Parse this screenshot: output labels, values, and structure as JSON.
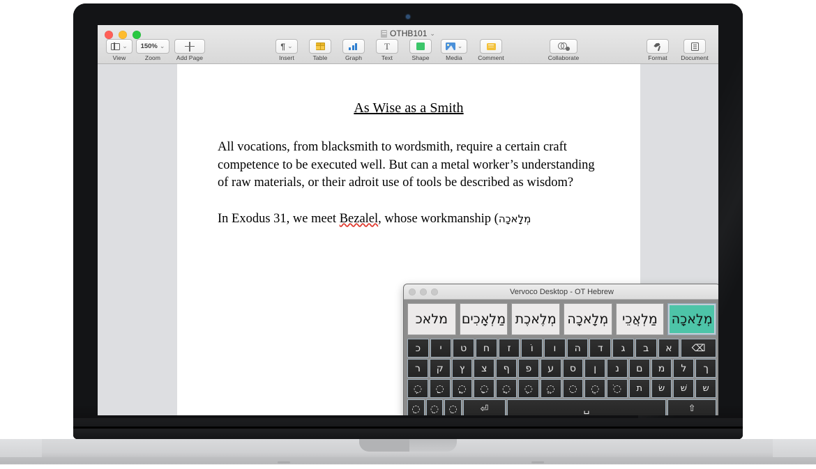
{
  "app": {
    "document_title": "OTHB101",
    "title_chevron": "⌄",
    "window_controls": [
      "close",
      "minimize",
      "zoom"
    ],
    "toolbar": {
      "left": [
        {
          "label": "View",
          "icon": "view-layout-icon",
          "has_chevron": true,
          "value": ""
        },
        {
          "label": "Zoom",
          "icon": "zoom-level-icon",
          "has_chevron": true,
          "value": "150%"
        },
        {
          "label": "Add Page",
          "icon": "plus-icon",
          "has_chevron": false,
          "value": ""
        }
      ],
      "middle": [
        {
          "label": "Insert",
          "icon": "pilcrow-icon",
          "has_chevron": true,
          "value": "¶"
        },
        {
          "label": "Table",
          "icon": "table-icon",
          "has_chevron": false,
          "value": ""
        },
        {
          "label": "Graph",
          "icon": "bar-chart-icon",
          "has_chevron": false,
          "value": ""
        },
        {
          "label": "Text",
          "icon": "text-t-icon",
          "has_chevron": false,
          "value": "T"
        },
        {
          "label": "Shape",
          "icon": "shape-icon",
          "has_chevron": false,
          "value": ""
        },
        {
          "label": "Media",
          "icon": "media-image-icon",
          "has_chevron": true,
          "value": ""
        },
        {
          "label": "Comment",
          "icon": "comment-icon",
          "has_chevron": false,
          "value": ""
        }
      ],
      "collaborate": {
        "label": "Collaborate",
        "icon": "collaborate-icon"
      },
      "right": [
        {
          "label": "Format",
          "icon": "format-brush-icon"
        },
        {
          "label": "Document",
          "icon": "document-icon"
        }
      ]
    }
  },
  "document": {
    "heading": "As Wise as a Smith",
    "paragraph1": "All vocations, from blacksmith to wordsmith, require a certain craft competence to be executed well. But can a metal worker’s understanding of raw materials, or their adroit use of tools be described as wisdom?",
    "paragraph2_part1": "In Exodus 31, we meet ",
    "paragraph2_misspelled": "Bezalel",
    "paragraph2_part2": ", whose workmanship (",
    "paragraph2_hebrew": "מְלָאכָה"
  },
  "ime": {
    "title": "Vervoco Desktop - OT Hebrew",
    "window_controls": [
      "close",
      "minimize",
      "zoom"
    ],
    "candidates": [
      {
        "text": "מְלָאכָה",
        "selected": true
      },
      {
        "text": "מַלְאֲכֵי",
        "selected": false
      },
      {
        "text": "מְלָאכָה",
        "selected": false
      },
      {
        "text": "מְלֶאכֶת",
        "selected": false
      },
      {
        "text": "מַלְאָכִים",
        "selected": false
      },
      {
        "text": "מלאכ",
        "selected": false
      }
    ],
    "keyboard": {
      "row1": [
        "⌫",
        "א",
        "ב",
        "ג",
        "ד",
        "ה",
        "ו",
        "וֹ",
        "ז",
        "ח",
        "ט",
        "י",
        "כ"
      ],
      "row2": [
        "ך",
        "ל",
        "מ",
        "ם",
        "נ",
        "ן",
        "ס",
        "ע",
        "פ",
        "ף",
        "צ",
        "ץ",
        "ק",
        "ר"
      ],
      "row3": [
        "ש",
        "שׁ",
        "שׂ",
        "ת",
        "◌ֹ",
        "◌ֻ",
        "◌ִ",
        "◌ֱ",
        "◌ֶ",
        "◌ֲ",
        "◌ָ",
        "◌ֳ",
        "◌ַ",
        "◌ְ"
      ],
      "row4_shift": "⇧",
      "row4_space": "␣",
      "row4_enter": "⏎",
      "row4_extra": [
        "◌ֵ",
        "◌ֵ",
        "◌ֵ"
      ]
    }
  },
  "colors": {
    "candidate_selected": "#4dc4a8",
    "key_background": "#2b2b2b",
    "key_border": "#9fb0bd",
    "ime_chrome": "#8d8d8d",
    "canvas_background": "#dddee1",
    "spellcheck_underline": "#e03a2f"
  }
}
